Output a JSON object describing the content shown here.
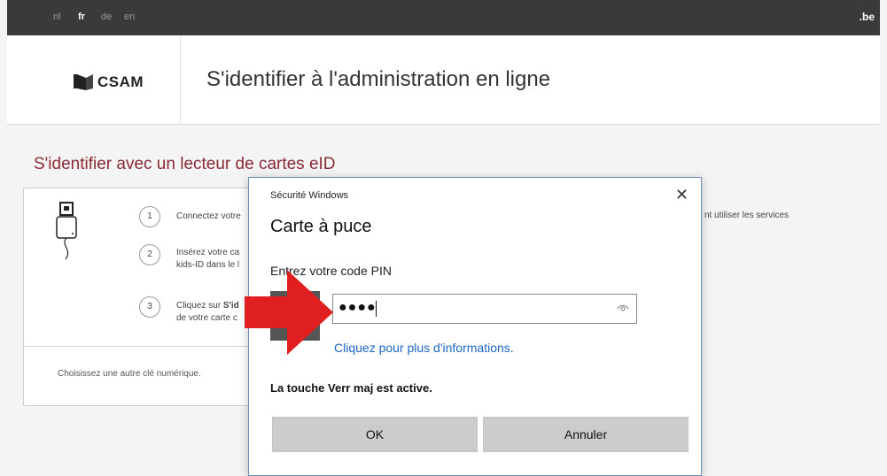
{
  "topbar": {
    "languages": [
      "nl",
      "fr",
      "de",
      "en"
    ],
    "active_language": "fr",
    "domain_badge": ".be"
  },
  "header": {
    "logo_text": "CSAM",
    "title": "S'identifier à l'administration en ligne"
  },
  "section": {
    "title": "S'identifier avec un lecteur de cartes eID"
  },
  "card": {
    "steps": [
      {
        "number": "1",
        "line1": "Connectez votre",
        "line2": ""
      },
      {
        "number": "2",
        "line1": "Insérez votre ca",
        "line2": "kids-ID dans le l"
      },
      {
        "number": "3",
        "line1_plain": "Cliquez sur ",
        "line1_bold": "S'id",
        "line2": "de votre carte c"
      }
    ],
    "other_key_link": "Choisissez une autre clé numérique.",
    "right_text": "nt utiliser les services"
  },
  "dialog": {
    "caption": "Sécurité Windows",
    "close_glyph": "✕",
    "title": "Carte à puce",
    "prompt": "Entrez votre code PIN",
    "pin_masked": "●●●●",
    "more_info": "Cliquez pour plus d'informations.",
    "caps_lock_warning": "La touche Verr maj est active.",
    "ok_label": "OK",
    "cancel_label": "Annuler"
  },
  "colors": {
    "accent_red": "#e02020",
    "link_blue": "#1b66c2",
    "section_title": "#8a2a34",
    "topbar": "#3a3a3a"
  }
}
